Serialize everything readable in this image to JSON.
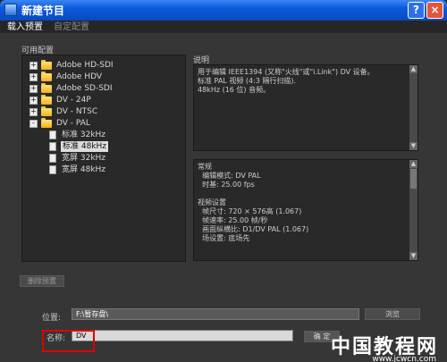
{
  "window": {
    "title": "新建节目",
    "help": "?",
    "close": "×"
  },
  "tabs": [
    {
      "label": "载入预置"
    },
    {
      "label": "自定配置"
    }
  ],
  "presets_label": "可用配置",
  "tree": [
    {
      "label": "Adobe HD-SDI",
      "expander": "+"
    },
    {
      "label": "Adobe HDV",
      "expander": "+"
    },
    {
      "label": "Adobe SD-SDI",
      "expander": "+"
    },
    {
      "label": "DV - 24P",
      "expander": "+"
    },
    {
      "label": "DV - NTSC",
      "expander": "+"
    },
    {
      "label": "DV - PAL",
      "expander": "-"
    },
    {
      "label": "标准 32kHz"
    },
    {
      "label": "标准 48kHz"
    },
    {
      "label": "宽屏 32kHz"
    },
    {
      "label": "宽屏 48kHz"
    }
  ],
  "description": {
    "label": "说明",
    "text": "用于编辑 IEEE1394 (又称\"火线\"或\"i.Link\") DV 设备。\n标准 PAL 视频 (4:3 隔行扫描).\n48kHz (16 位) 音频。"
  },
  "details": {
    "text": "常规\n  编辑模式: DV PAL\n  时基: 25.00 fps\n\n视频设置\n  帧尺寸: 720 × 576高 (1.067)\n  帧速率: 25.00 帧/秒\n  画面纵横比: D1/DV PAL (1.067)\n  场设置: 底场先"
  },
  "delete_preset": "删除预置",
  "location": {
    "label": "位置:",
    "value": "F:\\暂存盘\\",
    "browse": "浏览"
  },
  "name": {
    "label": "名称:",
    "value": "DV"
  },
  "ok": "确 定",
  "watermark": {
    "main": "中国教程网",
    "url": "www.jcwcn.com"
  },
  "colors": {
    "titlebar": "#0b5ad9",
    "body": "#363636",
    "panel": "#292929",
    "highlight": "#e00000"
  }
}
